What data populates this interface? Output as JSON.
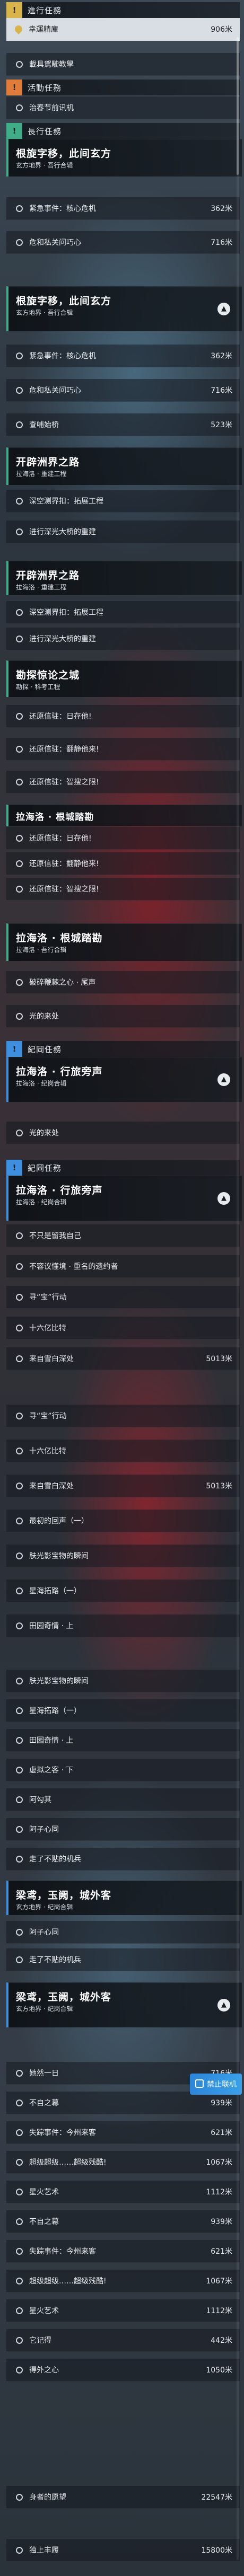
{
  "sections": {
    "ongoing": {
      "badge": "!",
      "title": "進行任務"
    },
    "activity": {
      "badge": "!",
      "title": "活動任務"
    },
    "story": {
      "badge": "!",
      "title": "長行任務"
    },
    "legend": {
      "badge": "!",
      "title": "紀岡任務"
    },
    "legend2": {
      "badge": "!",
      "title": "紀岡任務"
    }
  },
  "ongoing_rows": [
    {
      "label": "幸運精庫",
      "dist": "906米"
    },
    {
      "label": "載具駕駛教學",
      "dist": ""
    }
  ],
  "activity_rows": [
    {
      "label": "治春节前讯机",
      "dist": ""
    }
  ],
  "cards": [
    {
      "name": "根旋字移，此间玄方",
      "sub": "玄方地界 · 吾行合辑"
    },
    {
      "name": "根旋字移，此间玄方",
      "sub": "玄方地界 · 吾行合辑"
    },
    {
      "name": "开辟洲界之路",
      "sub": "拉海洛 · 重建工程"
    },
    {
      "name": "开辟洲界之路",
      "sub": "拉海洛 · 重建工程"
    },
    {
      "name": "勘探惊论之城",
      "sub": "勘探 · 科考工程"
    },
    {
      "name": "拉海洛 · 根城踏勘",
      "sub": ""
    },
    {
      "name": "拉海洛 · 根城踏勘",
      "sub": "拉海洛 · 吾行合辑"
    },
    {
      "name": "拉海洛 · 行旅旁声",
      "sub": "拉海洛 · 纪岗合辑"
    },
    {
      "name": "拉海洛 · 行旅旁声",
      "sub": "拉海洛 · 纪岗合辑"
    },
    {
      "name": "梁鸢，玉阙，城外客",
      "sub": "玄方地界 · 纪岗合辑"
    },
    {
      "name": "梁鸢，玉阙，城外客",
      "sub": "玄方地界 · 纪岗合辑"
    }
  ],
  "groupA": [
    {
      "label": "紧急事件：核心危机",
      "dist": "362米"
    },
    {
      "label": "危和私关问巧心",
      "dist": "716米"
    }
  ],
  "groupB": [
    {
      "label": "紧急事件：核心危机",
      "dist": "362米"
    },
    {
      "label": "危和私关问巧心",
      "dist": "716米"
    },
    {
      "label": "查哺始桥",
      "dist": "523米"
    }
  ],
  "groupC": [
    {
      "label": "深空测界扣：拓展工程",
      "dist": ""
    },
    {
      "label": "进行深光大桥的重建",
      "dist": ""
    }
  ],
  "groupD": [
    {
      "label": "深空测界扣：拓展工程",
      "dist": ""
    },
    {
      "label": "进行深光大桥的重建",
      "dist": ""
    }
  ],
  "groupE": [
    {
      "label": "还原信驻：日存他!",
      "dist": ""
    },
    {
      "label": "还原信驻：翻静他来!",
      "dist": ""
    },
    {
      "label": "还原信驻：智搜之限!",
      "dist": ""
    }
  ],
  "groupF": [
    {
      "label": "还原信驻：日存他!",
      "dist": ""
    },
    {
      "label": "还原信驻：翻静他来!",
      "dist": ""
    },
    {
      "label": "还原信驻：智搜之限!",
      "dist": ""
    }
  ],
  "groupG": [
    {
      "label": "破碎鞭棘之心 · 尾声",
      "dist": ""
    },
    {
      "label": "光的来处",
      "dist": ""
    }
  ],
  "groupH": [
    {
      "label": "光的来处",
      "dist": ""
    }
  ],
  "groupI": [
    {
      "label": "不只是留我自己",
      "dist": ""
    },
    {
      "label": "不容议懂境 · 重名的遗约者",
      "dist": ""
    },
    {
      "label": "寻“宝”行动",
      "dist": ""
    },
    {
      "label": "十六亿比特",
      "dist": ""
    },
    {
      "label": "来自雪白深处",
      "dist": "5013米"
    }
  ],
  "groupJ": [
    {
      "label": "寻“宝”行动",
      "dist": ""
    },
    {
      "label": "十六亿比特",
      "dist": ""
    },
    {
      "label": "来自雪白深处",
      "dist": "5013米"
    },
    {
      "label": "最初的回声（一）",
      "dist": ""
    },
    {
      "label": "肤光影宝物的瞬间",
      "dist": ""
    },
    {
      "label": "星海拓路（一）",
      "dist": ""
    },
    {
      "label": "田园奇情 · 上",
      "dist": ""
    }
  ],
  "groupK": [
    {
      "label": "肤光影宝物的瞬间",
      "dist": ""
    },
    {
      "label": "星海拓路（一）",
      "dist": ""
    },
    {
      "label": "田园奇情 · 上",
      "dist": ""
    },
    {
      "label": "虚拟之客 · 下",
      "dist": ""
    },
    {
      "label": "阿勾其",
      "dist": ""
    },
    {
      "label": "阿子心同",
      "dist": ""
    },
    {
      "label": "走了不贴的机兵",
      "dist": ""
    }
  ],
  "groupL": [
    {
      "label": "阿子心同",
      "dist": ""
    },
    {
      "label": "走了不贴的机兵",
      "dist": ""
    }
  ],
  "groupM": [
    {
      "label": "她然一日",
      "dist": "716米"
    },
    {
      "label": "不自之幕",
      "dist": "939米"
    },
    {
      "label": "失踪事件：今州来客",
      "dist": "621米"
    },
    {
      "label": "超级超级……超级残酷!",
      "dist": "1067米"
    },
    {
      "label": "星火艺术",
      "dist": "1112米"
    },
    {
      "label": "不自之幕",
      "dist": "939米"
    },
    {
      "label": "失踪事件：今州来客",
      "dist": "621米"
    },
    {
      "label": "超级超级……超级残酷!",
      "dist": "1067米"
    },
    {
      "label": "星火艺术",
      "dist": "1112米"
    },
    {
      "label": "它记得",
      "dist": "442米"
    },
    {
      "label": "得外之心",
      "dist": "1050米"
    },
    {
      "label": "身者的愿望",
      "dist": "22547米"
    },
    {
      "label": "独上丰履",
      "dist": "15800米"
    }
  ],
  "float_button": {
    "label": "禁止联机"
  }
}
